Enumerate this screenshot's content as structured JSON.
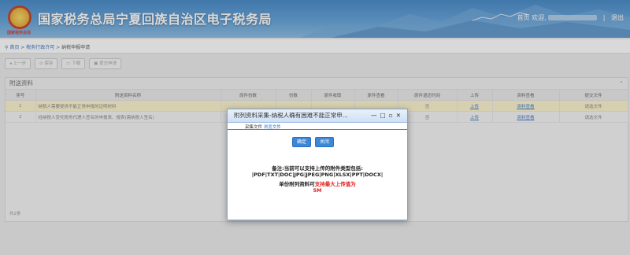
{
  "header": {
    "emblem_caption": "国家税务总局",
    "title": "国家税务总局宁夏回族自治区电子税务局",
    "home": "首页",
    "welcome": "欢迎,",
    "logout": "退出"
  },
  "breadcrumb": {
    "home": "首页",
    "sep": ">",
    "level1": "税务行政许可",
    "level2": "纳税申报申请"
  },
  "toolbar": {
    "buttons": [
      "上一步",
      "保存",
      "下载",
      "提交申请"
    ]
  },
  "panel": {
    "title": "附送资料",
    "collapse_icon": "chevron-up-icon",
    "footer": "共2条",
    "columns": [
      "序号",
      "附送资料名称",
      "原件份数",
      "份数",
      "原件收取",
      "原件查看",
      "原件退还时间",
      "上传",
      "资料查看",
      "提交文件"
    ],
    "rows": [
      {
        "index": "1",
        "name": "纳税人需要提供不能正常申报的证明材料",
        "copies_orig": "",
        "copies": "",
        "orig_received": "",
        "orig_view": "",
        "return_flag": "否",
        "upload": "上传",
        "view": "资料查看",
        "submit": "请选文件"
      },
      {
        "index": "2",
        "name": "经纳税人受托税务代理人签名的申报表、报表(需纳税人签名)",
        "copies_orig": "",
        "copies": "",
        "orig_received": "",
        "orig_view": "",
        "return_flag": "否",
        "upload": "上传",
        "view": "资料查看",
        "submit": "请选文件"
      }
    ]
  },
  "dialog": {
    "title": "附列资料采集-纳税人确有困难不能正常申...",
    "controls": [
      "—",
      "□",
      "▫",
      "✕"
    ],
    "tab_label": "采集文件",
    "tab_link": "浏览文件",
    "confirm": "确定",
    "close": "关闭",
    "note_line1": "备注:当前可以支持上传的附件类型包括:",
    "note_line2": "|PDF|TXT|DOC|JPG|JPEG|PNG|XLSX|PPT|DOCX|",
    "note_line3_prefix": "单份附列资料可",
    "note_line3_red": "支持最大上传值为",
    "note_line4": "5M"
  },
  "colors": {
    "header_blue": "#2d79c0",
    "link": "#2a6fc4",
    "dialog_button": "#3c87d6",
    "warning_red": "#e02020",
    "selected_row": "#fbf3c7"
  }
}
